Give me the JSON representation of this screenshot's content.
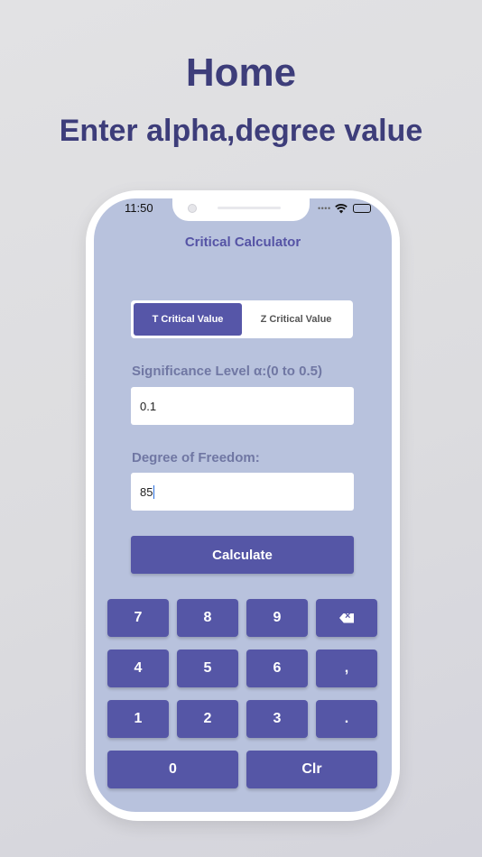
{
  "promo": {
    "title": "Home",
    "subtitle": "Enter alpha,degree value"
  },
  "status_bar": {
    "time": "11:50",
    "icons": [
      "signal-dots-icon",
      "wifi-icon",
      "battery-icon"
    ]
  },
  "app": {
    "title": "Critical Calculator",
    "tabs": [
      {
        "label": "T Critical Value",
        "active": true
      },
      {
        "label": "Z Critical Value",
        "active": false
      }
    ],
    "significance": {
      "label": "Significance Level α:(0 to 0.5)",
      "value": "0.1"
    },
    "degree": {
      "label": "Degree of Freedom:",
      "value": "85"
    },
    "calculate_label": "Calculate"
  },
  "keypad": {
    "keys": [
      "7",
      "8",
      "9",
      "4",
      "5",
      "6",
      ",",
      "1",
      "2",
      "3",
      ".",
      "0",
      "Clr"
    ]
  },
  "colors": {
    "accent": "#5556a6",
    "screen_bg": "#b8c2dd",
    "title_text": "#3d3d7a"
  }
}
